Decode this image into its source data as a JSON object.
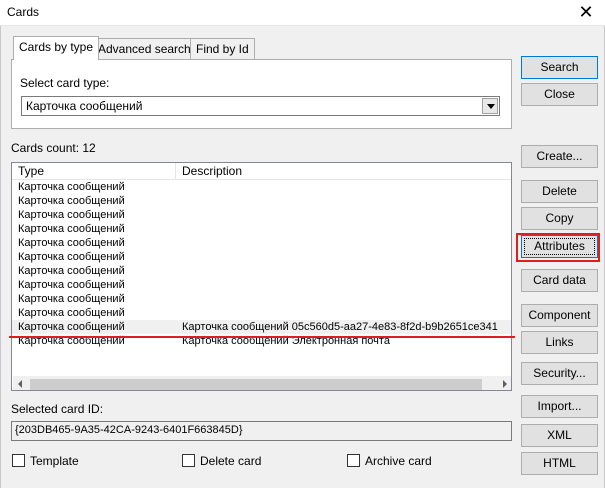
{
  "window": {
    "title": "Cards",
    "close_glyph": "✕"
  },
  "tabs": [
    {
      "label": "Cards by type",
      "active": true
    },
    {
      "label": "Advanced search",
      "active": false
    },
    {
      "label": "Find by Id",
      "active": false
    }
  ],
  "card_type": {
    "label": "Select card type:",
    "value": "Карточка сообщений"
  },
  "cards_count_label": "Cards count: 12",
  "list": {
    "columns": [
      "Type",
      "Description"
    ],
    "rows": [
      {
        "type": "Карточка сообщений",
        "description": ""
      },
      {
        "type": "Карточка сообщений",
        "description": ""
      },
      {
        "type": "Карточка сообщений",
        "description": ""
      },
      {
        "type": "Карточка сообщений",
        "description": ""
      },
      {
        "type": "Карточка сообщений",
        "description": ""
      },
      {
        "type": "Карточка сообщений",
        "description": ""
      },
      {
        "type": "Карточка сообщений",
        "description": ""
      },
      {
        "type": "Карточка сообщений",
        "description": ""
      },
      {
        "type": "Карточка сообщений",
        "description": ""
      },
      {
        "type": "Карточка сообщений",
        "description": ""
      },
      {
        "type": "Карточка сообщений",
        "description": "Карточка сообщений 05c560d5-aa27-4e83-8f2d-b9b2651ce341",
        "selected": true
      },
      {
        "type": "Карточка сообщений",
        "description": "Карточка сообщений Электронная почта"
      }
    ]
  },
  "selected_card": {
    "label": "Selected card ID:",
    "value": "{203DB465-9A35-42CA-9243-6401F663845D}"
  },
  "checkboxes": [
    {
      "label": "Template",
      "checked": false
    },
    {
      "label": "Delete card",
      "checked": false
    },
    {
      "label": "Archive card",
      "checked": false
    }
  ],
  "buttons": {
    "search": "Search",
    "close": "Close",
    "create": "Create...",
    "delete": "Delete",
    "copy": "Copy",
    "attributes": "Attributes",
    "card_data": "Card data",
    "component": "Component",
    "links": "Links",
    "security": "Security...",
    "import": "Import...",
    "xml": "XML",
    "html": "HTML"
  },
  "annotation_color": "#e01e1e"
}
